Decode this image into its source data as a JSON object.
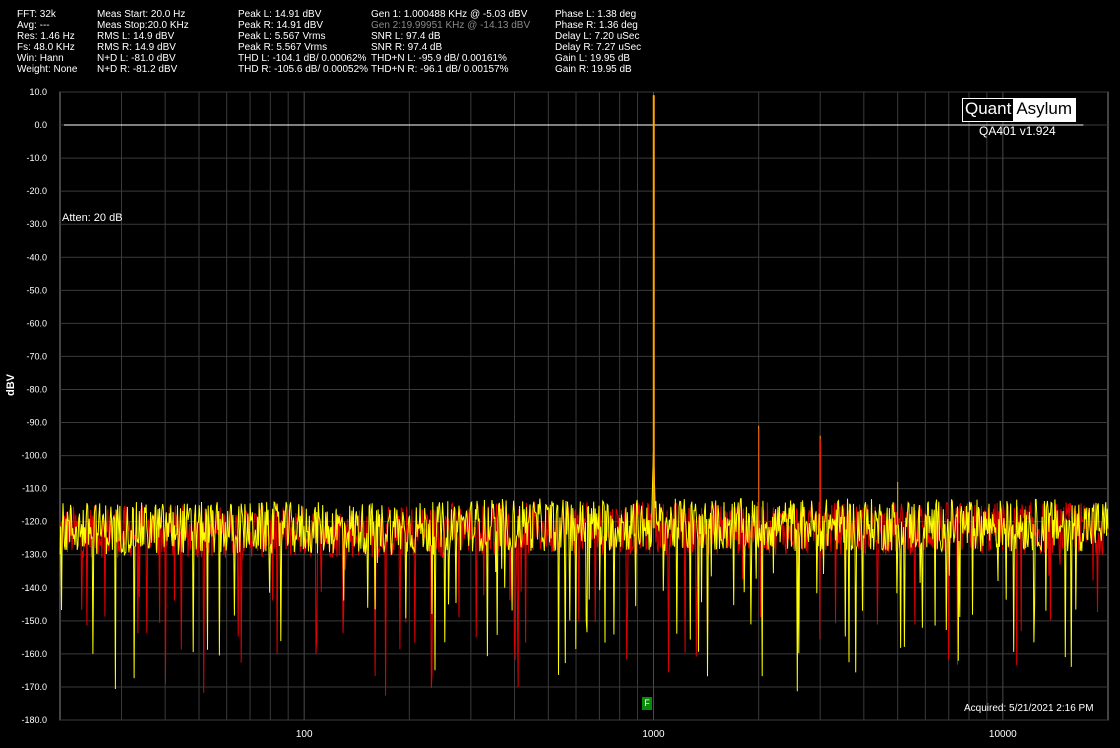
{
  "stats": {
    "col1": [
      "FFT: 32k",
      "Avg: ---",
      "Res: 1.46 Hz",
      "Fs: 48.0 KHz",
      "Win: Hann",
      "Weight: None"
    ],
    "col2": [
      "Meas Start: 20.0 Hz",
      "Meas Stop:20.0 KHz",
      "RMS L: 14.9 dBV",
      "RMS R: 14.9 dBV",
      "N+D L: -81.0 dBV",
      "N+D R: -81.2 dBV"
    ],
    "col3": [
      "Peak L: 14.91 dBV",
      "Peak R: 14.91 dBV",
      "Peak L: 5.567 Vrms",
      "Peak R: 5.567 Vrms",
      "THD L: -104.1 dB/ 0.00062%",
      "THD R: -105.6 dB/ 0.00052%"
    ],
    "col4": [
      "Gen 1: 1.000488 KHz @ -5.03  dBV",
      "Gen 2:19.99951 KHz @ -14.13  dBV",
      "SNR L: 97.4 dB",
      "SNR R: 97.4 dB",
      "THD+N L: -95.9 dB/ 0.00161%",
      "THD+N R: -96.1 dB/ 0.00157%"
    ],
    "col5": [
      "Phase L: 1.38 deg",
      "Phase R: 1.36 deg",
      "Delay L: 7.20 uSec",
      "Delay R: 7.27 uSec",
      "Gain L: 19.95 dB",
      "Gain R: 19.95 dB"
    ]
  },
  "logo": {
    "part1": "Quant",
    "part2": "Asylum"
  },
  "version": "QA401 v1.924",
  "atten": "Atten: 20 dB",
  "acquired": "Acquired: 5/21/2021  2:16 PM",
  "fund_marker": "F",
  "colors": {
    "left": "#ffff00",
    "right": "#e00000",
    "fundamental": "#ffa500",
    "reference": "#ffffff",
    "grid": "#3a3a3a"
  },
  "chart_data": {
    "type": "line",
    "xscale": "log",
    "xlim": [
      20,
      20000
    ],
    "ylim": [
      -180,
      10
    ],
    "ylabel": "dBV",
    "xlabel": "",
    "yticks": [
      "10.0",
      "0.0",
      "-10.0",
      "-20.0",
      "-30.0",
      "-40.0",
      "-50.0",
      "-60.0",
      "-70.0",
      "-80.0",
      "-90.0",
      "-100.0",
      "-110.0",
      "-120.0",
      "-130.0",
      "-140.0",
      "-150.0",
      "-160.0",
      "-170.0",
      "-180.0"
    ],
    "xticks": [
      "100",
      "1000",
      "10000"
    ],
    "reference_line": 0,
    "noise_floor": -122,
    "series": [
      {
        "color_key": "left",
        "peaks": [
          {
            "x": 1000,
            "y": 9
          },
          {
            "x": 2000,
            "y": -91
          },
          {
            "x": 3000,
            "y": -94
          },
          {
            "x": 5000,
            "y": -108
          }
        ]
      },
      {
        "color_key": "right",
        "peaks": [
          {
            "x": 1000,
            "y": 9
          },
          {
            "x": 2000,
            "y": -92
          },
          {
            "x": 3000,
            "y": -95
          }
        ]
      }
    ]
  }
}
